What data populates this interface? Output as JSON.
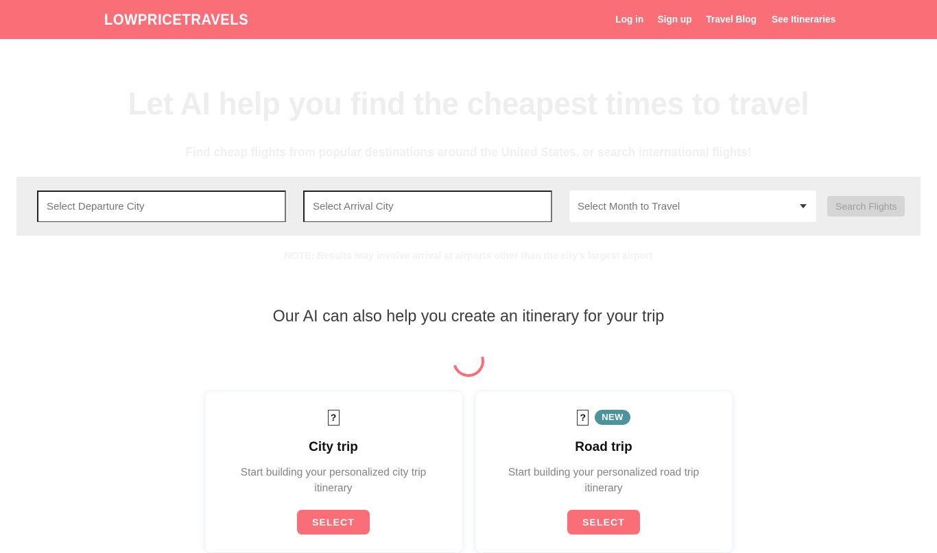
{
  "header": {
    "brand": "LOWPRICETRAVELS",
    "brand_bg": "#fa6e78",
    "nav": [
      {
        "label": "Log in"
      },
      {
        "label": "Sign up"
      },
      {
        "label": "Travel Blog"
      },
      {
        "label": "See Itineraries"
      }
    ]
  },
  "hero": {
    "title": "Let AI help you find the cheapest times to travel",
    "subtitle": "Find cheap flights from popular destinations around the United States, or search international flights!",
    "title_color": "#eeeeee"
  },
  "search": {
    "departure_placeholder": "Select Departure City",
    "departure_value": "",
    "arrival_placeholder": "Select Arrival City",
    "arrival_value": "",
    "month_selected": "Select Month to Travel",
    "month_caret_icon": "chevron-down-icon",
    "submit_label": "Search Flights",
    "submit_disabled": true,
    "band_bg": "#eeeeee",
    "note": "NOTE: Results may involve arrival at airports other than the city's largest airport"
  },
  "itinerary": {
    "heading": "Our AI can also help you create an itinerary for your trip",
    "spinner_icon": "loading-spinner-icon",
    "spinner_color": "#fa6e78",
    "cards": [
      {
        "icon": "missing-glyph-icon",
        "icon_glyph": "?",
        "badge": null,
        "title": "City trip",
        "description": "Start building your personalized city trip itinerary",
        "button_label": "SELECT"
      },
      {
        "icon": "missing-glyph-icon",
        "icon_glyph": "?",
        "badge": "NEW",
        "badge_color": "#4c939b",
        "title": "Road trip",
        "description": "Start building your personalized road trip itinerary",
        "button_label": "SELECT"
      }
    ]
  }
}
